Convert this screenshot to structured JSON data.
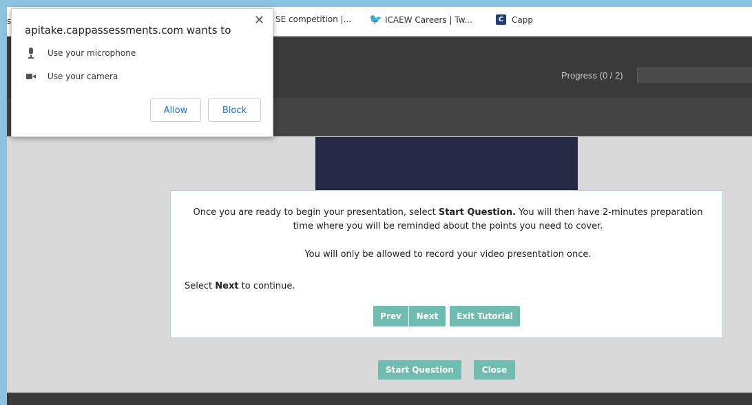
{
  "bookmarks": {
    "fragment": "s",
    "items": [
      {
        "label": "SE competition |...",
        "icon": "none"
      },
      {
        "label": "ICAEW Careers | Tw...",
        "icon": "twitter-icon"
      },
      {
        "label": "Capp",
        "icon": "capp-icon"
      }
    ]
  },
  "header": {
    "progress_label": "Progress (0 / 2)",
    "progress_value": 0
  },
  "tutorial": {
    "p1_before": "Once you are ready to begin your presentation, select ",
    "p1_bold": "Start Question.",
    "p1_after": " You will then have 2-minutes preparation time where you will be reminded about the points you need to cover.",
    "p2": "You will only be allowed to record your video presentation once.",
    "p3_before": "Select ",
    "p3_bold": "Next",
    "p3_after": " to continue.",
    "prev_label": "Prev",
    "next_label": "Next",
    "exit_label": "Exit Tutorial"
  },
  "actions": {
    "start_label": "Start Question",
    "close_label": "Close"
  },
  "permission": {
    "title": "apitake.cappassessments.com wants to",
    "close_glyph": "✕",
    "microphone_label": "Use your microphone",
    "camera_label": "Use your camera",
    "allow_label": "Allow",
    "block_label": "Block"
  },
  "colors": {
    "accent": "#6fbdb0",
    "header_bg": "#3a3a3a",
    "video_bg": "#262a45"
  }
}
